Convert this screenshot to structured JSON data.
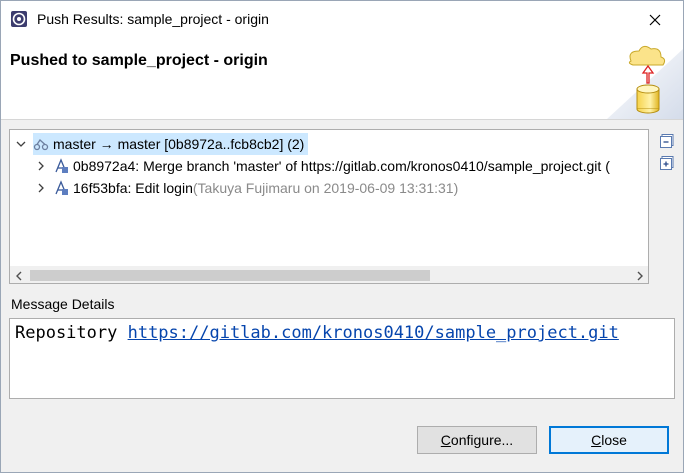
{
  "window": {
    "title": "Push Results: sample_project - origin"
  },
  "banner": {
    "title": "Pushed to sample_project - origin"
  },
  "tree": {
    "root": {
      "label": "master → master [0b8972a..fcb8cb2] (2)"
    },
    "commits": [
      {
        "label": "0b8972a4: Merge branch 'master' of https://gitlab.com/kronos0410/sample_project.git (",
        "meta": ""
      },
      {
        "label": "16f53bfa: Edit login",
        "meta": " (Takuya Fujimaru on 2019-06-09 13:31:31)"
      }
    ]
  },
  "details": {
    "heading": "Message Details",
    "prefix": "Repository ",
    "link": "https://gitlab.com/kronos0410/sample_project.git"
  },
  "buttons": {
    "configure_first": "C",
    "configure_rest": "onfigure...",
    "close_first": "C",
    "close_rest": "lose"
  },
  "colors": {
    "selection": "#cce8ff",
    "link": "#0645ad",
    "default_button_border": "#0078d7"
  }
}
